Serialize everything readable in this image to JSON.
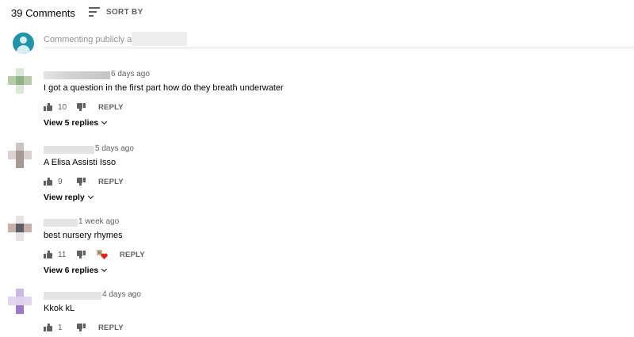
{
  "header": {
    "comment_count": "39 Comments",
    "sort_label": "SORT BY",
    "sort_icon": "sort-icon"
  },
  "add_comment": {
    "publicly_label": "Commenting publicly as"
  },
  "comments": [
    {
      "time": "6 days ago",
      "text": "I got a question in the first part how do they breath underwater",
      "likes": "10",
      "reply": "REPLY",
      "view_replies": "View 5 replies"
    },
    {
      "time": "5 days ago",
      "text": "A Elisa Assisti Isso",
      "likes": "9",
      "reply": "REPLY",
      "view_replies": "View reply"
    },
    {
      "time": "1 week ago",
      "text": "best nursery rhymes",
      "likes": "11",
      "reply": "REPLY",
      "view_replies": "View 6 replies",
      "creator_heart": true
    },
    {
      "time": "4 days ago",
      "text": "Kkok kL",
      "likes": "1",
      "reply": "REPLY"
    }
  ],
  "colors": {
    "channel_avatar": "#2294a7",
    "secondary_text": "#606060",
    "heart": "#e8201a"
  }
}
